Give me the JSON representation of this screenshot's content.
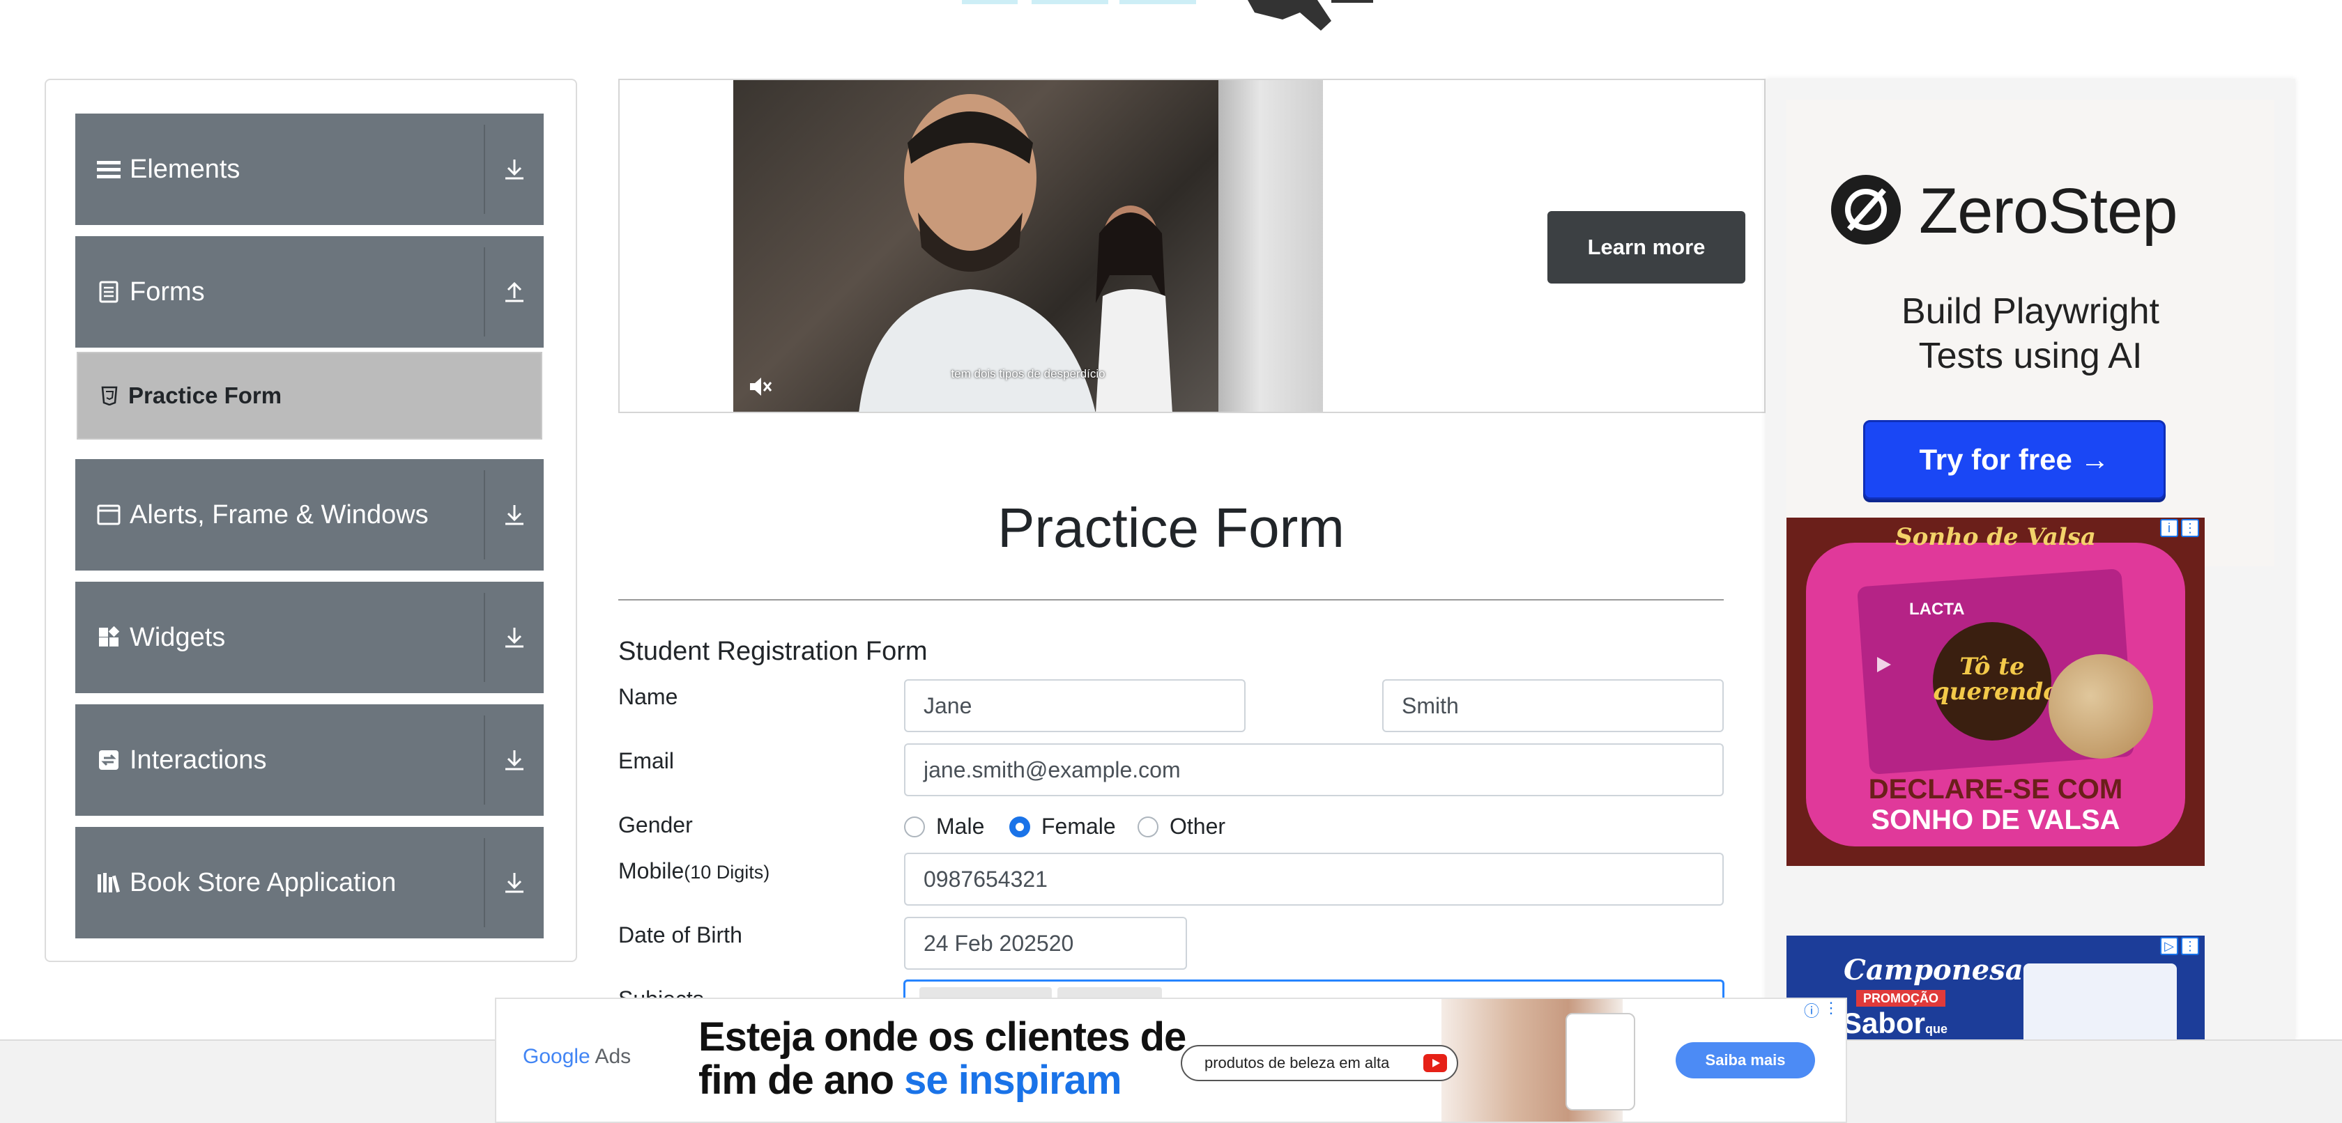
{
  "sidebar": {
    "groups": [
      {
        "label": "Elements",
        "icon": "hamburger-icon",
        "arrow": "download-icon"
      },
      {
        "label": "Forms",
        "icon": "document-icon",
        "arrow": "upload-icon"
      },
      {
        "label": "Alerts, Frame & Windows",
        "icon": "window-icon",
        "arrow": "download-icon"
      },
      {
        "label": "Widgets",
        "icon": "widgets-icon",
        "arrow": "download-icon"
      },
      {
        "label": "Interactions",
        "icon": "interactions-icon",
        "arrow": "download-icon"
      },
      {
        "label": "Book Store Application",
        "icon": "books-icon",
        "arrow": "download-icon"
      }
    ],
    "active_item": {
      "label": "Practice Form",
      "icon": "html5-icon"
    }
  },
  "video_ad": {
    "caption": "tem dois tipos de desperdício",
    "cta": "Learn more"
  },
  "main": {
    "title": "Practice Form",
    "form_title": "Student Registration Form",
    "labels": {
      "name": "Name",
      "email": "Email",
      "gender": "Gender",
      "mobile": "Mobile",
      "mobile_hint": "(10 Digits)",
      "dob": "Date of Birth",
      "subjects": "Subjects"
    },
    "fields": {
      "first_name": "Jane",
      "last_name": "Smith",
      "email": "jane.smith@example.com",
      "mobile": "0987654321",
      "dob": "24 Feb 202520"
    },
    "gender_options": [
      {
        "label": "Male",
        "checked": false
      },
      {
        "label": "Female",
        "checked": true
      },
      {
        "label": "Other",
        "checked": false
      }
    ]
  },
  "right_ads": {
    "zerostep": {
      "name": "ZeroStep",
      "tagline_1": "Build Playwright",
      "tagline_2": "Tests using AI",
      "cta": "Try for free →"
    },
    "sonho": {
      "brand": "Sonho de Valsa",
      "maker": "LACTA",
      "script_1": "Tô te",
      "script_2": "querendo",
      "line1": "DECLARE-SE COM",
      "line2": "SONHO DE VALSA"
    },
    "camponesa": {
      "brand": "Camponesa",
      "promo": "PROMOÇÃO",
      "sabor": "Sabor",
      "sabor_small": "que"
    }
  },
  "bottom_ad": {
    "logo_google": "Google",
    "logo_ads": "Ads",
    "headline_1": "Esteja onde os clientes de",
    "headline_2a": "fim de ano ",
    "headline_2b": "se inspiram",
    "search_text": "produtos de beleza em alta",
    "cta": "Saiba mais"
  },
  "colors": {
    "sidebar_group": "#6c757d",
    "sidebar_active": "#bbbbbb",
    "accent_blue": "#1a73e8",
    "zerostep_button": "#1a47f5"
  }
}
